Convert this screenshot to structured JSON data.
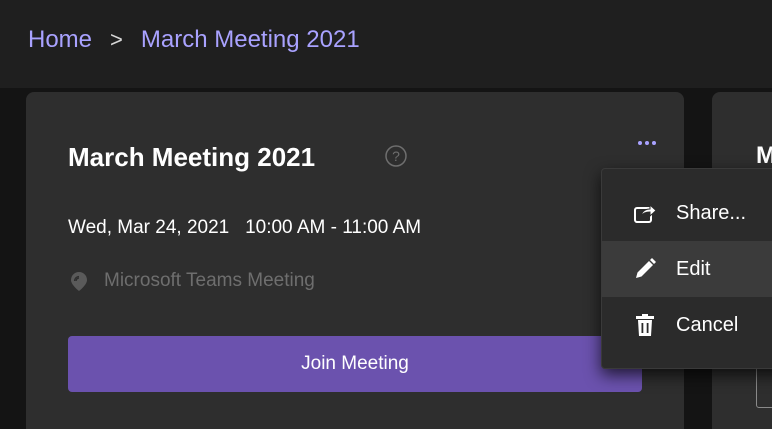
{
  "breadcrumb": {
    "home": "Home",
    "separator": ">",
    "current": "March Meeting 2021"
  },
  "meeting": {
    "title": "March Meeting 2021",
    "datetime": "Wed, Mar 24, 2021   10:00 AM - 11:00 AM",
    "location": "Microsoft Teams Meeting",
    "join_label": "Join Meeting"
  },
  "second_card": {
    "title_partial": "M"
  },
  "menu": {
    "items": [
      {
        "label": "Share...",
        "icon": "share-icon"
      },
      {
        "label": "Edit",
        "icon": "pencil-icon"
      },
      {
        "label": "Cancel",
        "icon": "trash-icon"
      }
    ]
  },
  "colors": {
    "accent": "#a9a2ff",
    "brand_button": "#6b52ae",
    "background": "#1f1f1f",
    "card": "#2e2e2e"
  }
}
